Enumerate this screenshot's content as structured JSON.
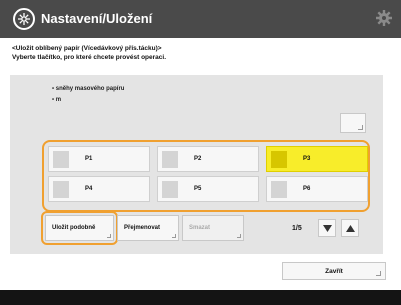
{
  "header": {
    "title": "Nastavení/Uložení"
  },
  "instruction": {
    "line1": "<Uložit oblíbený papír (Vícedávkový přís.tácku)>",
    "line2": "Vyberte tlačítko, pro které chcete provést operaci."
  },
  "paper_list": [
    "sněhy masového papíru",
    "m"
  ],
  "drawers": [
    {
      "label": "P1",
      "selected": false
    },
    {
      "label": "P2",
      "selected": false
    },
    {
      "label": "P3",
      "selected": true
    },
    {
      "label": "P4",
      "selected": false
    },
    {
      "label": "P5",
      "selected": false
    },
    {
      "label": "P6",
      "selected": false
    }
  ],
  "actions": {
    "save": "Uložit podobně",
    "rename": "Přejmenovat",
    "delete": "Smazat"
  },
  "pager": {
    "current": "1/5"
  },
  "close_label": "Zavřít"
}
